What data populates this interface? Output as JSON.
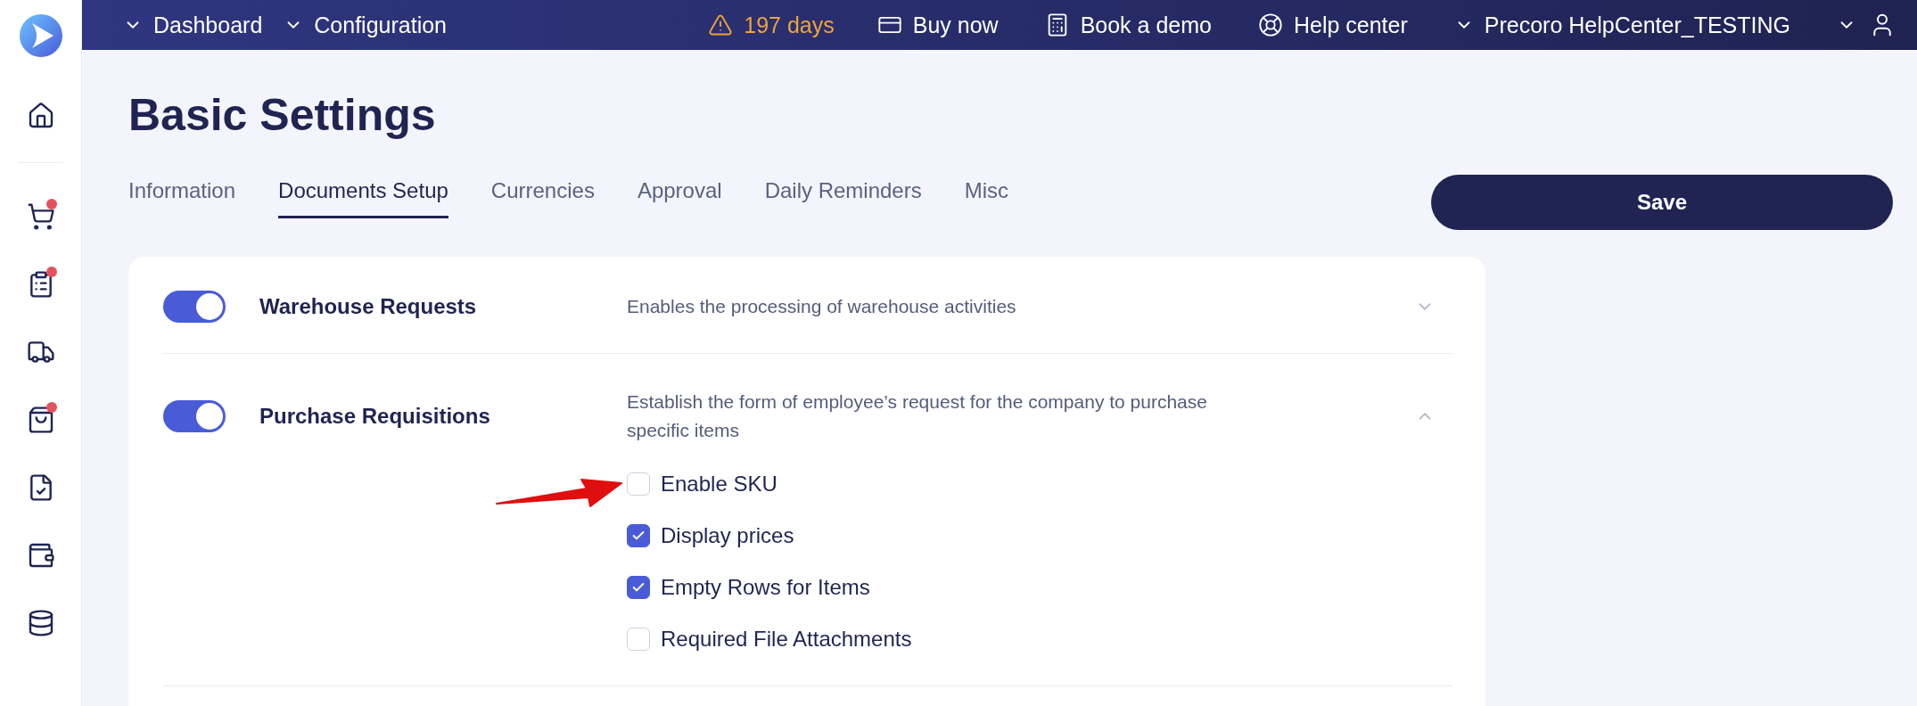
{
  "sidebar": {
    "items": [
      {
        "kind": "home",
        "badge": false
      },
      {
        "kind": "cart",
        "badge": true
      },
      {
        "kind": "checklist-user",
        "badge": true
      },
      {
        "kind": "truck-search",
        "badge": false
      },
      {
        "kind": "bag",
        "badge": true
      },
      {
        "kind": "file-check",
        "badge": false
      },
      {
        "kind": "wallet",
        "badge": false
      },
      {
        "kind": "checklist-db",
        "badge": false
      }
    ]
  },
  "topbar": {
    "nav": [
      {
        "label": "Dashboard"
      },
      {
        "label": "Configuration"
      }
    ],
    "trial": {
      "text": "197 days"
    },
    "links": [
      {
        "kind": "buy",
        "label": "Buy now"
      },
      {
        "kind": "demo",
        "label": "Book a demo"
      },
      {
        "kind": "help",
        "label": "Help center"
      }
    ],
    "account": {
      "label": "Precoro HelpCenter_TESTING"
    }
  },
  "page": {
    "title": "Basic Settings"
  },
  "tabs": [
    {
      "label": "Information",
      "selected": false
    },
    {
      "label": "Documents Setup",
      "selected": true
    },
    {
      "label": "Currencies",
      "selected": false
    },
    {
      "label": "Approval",
      "selected": false
    },
    {
      "label": "Daily Reminders",
      "selected": false
    },
    {
      "label": "Misc",
      "selected": false
    }
  ],
  "save_button": {
    "label": "Save"
  },
  "settings": [
    {
      "title": "Warehouse Requests",
      "description": "Enables the processing of warehouse activities",
      "on": true,
      "expanded": false
    },
    {
      "title": "Purchase Requisitions",
      "description": "Establish the form of employee’s request for the company to purchase specific items",
      "on": true,
      "expanded": true,
      "options": [
        {
          "label": "Enable SKU",
          "checked": false
        },
        {
          "label": "Display prices",
          "checked": true
        },
        {
          "label": "Empty Rows for Items",
          "checked": true
        },
        {
          "label": "Required File Attachments",
          "checked": false
        }
      ]
    }
  ]
}
